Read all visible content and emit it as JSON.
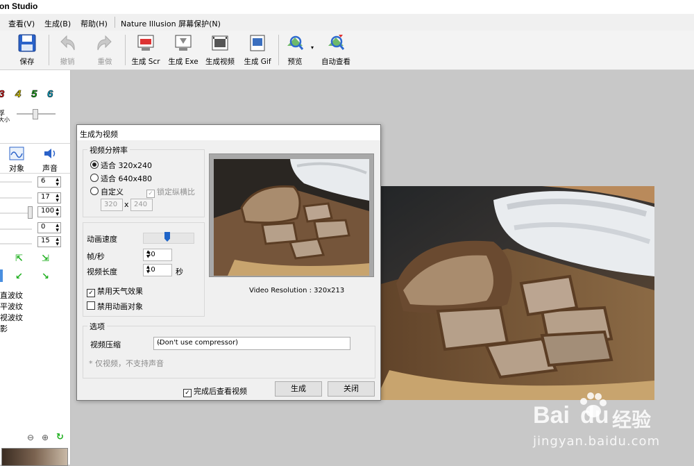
{
  "window": {
    "title": "on Studio"
  },
  "menu": {
    "items": [
      "查看(V)",
      "生成(B)",
      "帮助(H)",
      "Nature Illusion 屏幕保护(N)"
    ]
  },
  "toolbar": {
    "save": "保存",
    "undo": "撤销",
    "redo": "重做",
    "gen_scr": "生成 Scr",
    "gen_exe": "生成 Exe",
    "gen_video": "生成视频",
    "gen_gif": "生成 Gif",
    "preview": "预览",
    "auto_view": "自动查看"
  },
  "left_panel": {
    "layer_numbers": [
      "3",
      "4",
      "5",
      "6"
    ],
    "size_label_1": "孚",
    "size_label_2": "大小",
    "tab_object": "对象",
    "tab_sound": "声音",
    "spin_values": [
      "6",
      "17",
      "100",
      "0",
      "15"
    ],
    "effects": [
      "直波纹",
      "平波纹",
      "视波纹",
      "影"
    ]
  },
  "dialog": {
    "title": "生成为视频",
    "resolution_group": "视频分辨率",
    "res_320": "适合 320x240",
    "res_640": "适合 640x480",
    "res_custom": "自定义",
    "lock_ratio": "锁定纵横比",
    "custom_w": "320",
    "custom_x": "x",
    "custom_h": "240",
    "anim_speed": "动画速度",
    "fps_label": "帧/秒",
    "fps_value": "30",
    "length_label": "视频长度",
    "length_value": "10",
    "length_unit": "秒",
    "disable_weather": "禁用天气效果",
    "disable_anim_obj": "禁用动画对象",
    "video_res_text": "Video Resolution : 320x213",
    "options_group": "选项",
    "compress_label": "视频压缩",
    "compress_value": "(Don't use compressor)",
    "note": "* 仅视频，不支持声音",
    "view_after": "完成后查看视频",
    "generate": "生成",
    "close": "关闭"
  },
  "watermark": {
    "brand": "Bai",
    "brand2": "du",
    "cn": "经验",
    "url": "jingyan.baidu.com"
  },
  "colors": {
    "accent_blue": "#1e64c8",
    "num3": "#e02020",
    "num4": "#e8d800",
    "num5": "#20b020",
    "num6": "#10a8c8"
  }
}
